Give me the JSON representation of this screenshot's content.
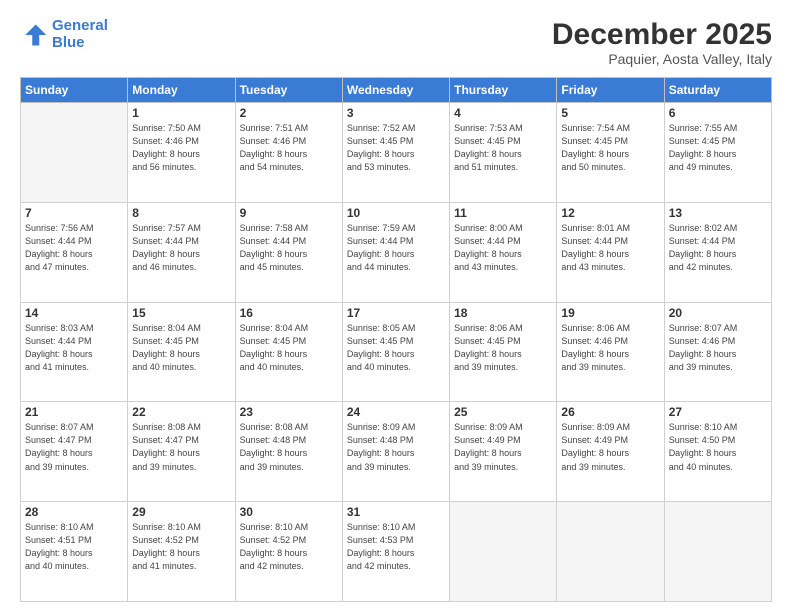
{
  "header": {
    "logo_general": "General",
    "logo_blue": "Blue",
    "month_title": "December 2025",
    "location": "Paquier, Aosta Valley, Italy"
  },
  "days_of_week": [
    "Sunday",
    "Monday",
    "Tuesday",
    "Wednesday",
    "Thursday",
    "Friday",
    "Saturday"
  ],
  "weeks": [
    [
      {
        "day": "",
        "info": ""
      },
      {
        "day": "1",
        "info": "Sunrise: 7:50 AM\nSunset: 4:46 PM\nDaylight: 8 hours\nand 56 minutes."
      },
      {
        "day": "2",
        "info": "Sunrise: 7:51 AM\nSunset: 4:46 PM\nDaylight: 8 hours\nand 54 minutes."
      },
      {
        "day": "3",
        "info": "Sunrise: 7:52 AM\nSunset: 4:45 PM\nDaylight: 8 hours\nand 53 minutes."
      },
      {
        "day": "4",
        "info": "Sunrise: 7:53 AM\nSunset: 4:45 PM\nDaylight: 8 hours\nand 51 minutes."
      },
      {
        "day": "5",
        "info": "Sunrise: 7:54 AM\nSunset: 4:45 PM\nDaylight: 8 hours\nand 50 minutes."
      },
      {
        "day": "6",
        "info": "Sunrise: 7:55 AM\nSunset: 4:45 PM\nDaylight: 8 hours\nand 49 minutes."
      }
    ],
    [
      {
        "day": "7",
        "info": "Sunrise: 7:56 AM\nSunset: 4:44 PM\nDaylight: 8 hours\nand 47 minutes."
      },
      {
        "day": "8",
        "info": "Sunrise: 7:57 AM\nSunset: 4:44 PM\nDaylight: 8 hours\nand 46 minutes."
      },
      {
        "day": "9",
        "info": "Sunrise: 7:58 AM\nSunset: 4:44 PM\nDaylight: 8 hours\nand 45 minutes."
      },
      {
        "day": "10",
        "info": "Sunrise: 7:59 AM\nSunset: 4:44 PM\nDaylight: 8 hours\nand 44 minutes."
      },
      {
        "day": "11",
        "info": "Sunrise: 8:00 AM\nSunset: 4:44 PM\nDaylight: 8 hours\nand 43 minutes."
      },
      {
        "day": "12",
        "info": "Sunrise: 8:01 AM\nSunset: 4:44 PM\nDaylight: 8 hours\nand 43 minutes."
      },
      {
        "day": "13",
        "info": "Sunrise: 8:02 AM\nSunset: 4:44 PM\nDaylight: 8 hours\nand 42 minutes."
      }
    ],
    [
      {
        "day": "14",
        "info": "Sunrise: 8:03 AM\nSunset: 4:44 PM\nDaylight: 8 hours\nand 41 minutes."
      },
      {
        "day": "15",
        "info": "Sunrise: 8:04 AM\nSunset: 4:45 PM\nDaylight: 8 hours\nand 40 minutes."
      },
      {
        "day": "16",
        "info": "Sunrise: 8:04 AM\nSunset: 4:45 PM\nDaylight: 8 hours\nand 40 minutes."
      },
      {
        "day": "17",
        "info": "Sunrise: 8:05 AM\nSunset: 4:45 PM\nDaylight: 8 hours\nand 40 minutes."
      },
      {
        "day": "18",
        "info": "Sunrise: 8:06 AM\nSunset: 4:45 PM\nDaylight: 8 hours\nand 39 minutes."
      },
      {
        "day": "19",
        "info": "Sunrise: 8:06 AM\nSunset: 4:46 PM\nDaylight: 8 hours\nand 39 minutes."
      },
      {
        "day": "20",
        "info": "Sunrise: 8:07 AM\nSunset: 4:46 PM\nDaylight: 8 hours\nand 39 minutes."
      }
    ],
    [
      {
        "day": "21",
        "info": "Sunrise: 8:07 AM\nSunset: 4:47 PM\nDaylight: 8 hours\nand 39 minutes."
      },
      {
        "day": "22",
        "info": "Sunrise: 8:08 AM\nSunset: 4:47 PM\nDaylight: 8 hours\nand 39 minutes."
      },
      {
        "day": "23",
        "info": "Sunrise: 8:08 AM\nSunset: 4:48 PM\nDaylight: 8 hours\nand 39 minutes."
      },
      {
        "day": "24",
        "info": "Sunrise: 8:09 AM\nSunset: 4:48 PM\nDaylight: 8 hours\nand 39 minutes."
      },
      {
        "day": "25",
        "info": "Sunrise: 8:09 AM\nSunset: 4:49 PM\nDaylight: 8 hours\nand 39 minutes."
      },
      {
        "day": "26",
        "info": "Sunrise: 8:09 AM\nSunset: 4:49 PM\nDaylight: 8 hours\nand 39 minutes."
      },
      {
        "day": "27",
        "info": "Sunrise: 8:10 AM\nSunset: 4:50 PM\nDaylight: 8 hours\nand 40 minutes."
      }
    ],
    [
      {
        "day": "28",
        "info": "Sunrise: 8:10 AM\nSunset: 4:51 PM\nDaylight: 8 hours\nand 40 minutes."
      },
      {
        "day": "29",
        "info": "Sunrise: 8:10 AM\nSunset: 4:52 PM\nDaylight: 8 hours\nand 41 minutes."
      },
      {
        "day": "30",
        "info": "Sunrise: 8:10 AM\nSunset: 4:52 PM\nDaylight: 8 hours\nand 42 minutes."
      },
      {
        "day": "31",
        "info": "Sunrise: 8:10 AM\nSunset: 4:53 PM\nDaylight: 8 hours\nand 42 minutes."
      },
      {
        "day": "",
        "info": ""
      },
      {
        "day": "",
        "info": ""
      },
      {
        "day": "",
        "info": ""
      }
    ]
  ]
}
